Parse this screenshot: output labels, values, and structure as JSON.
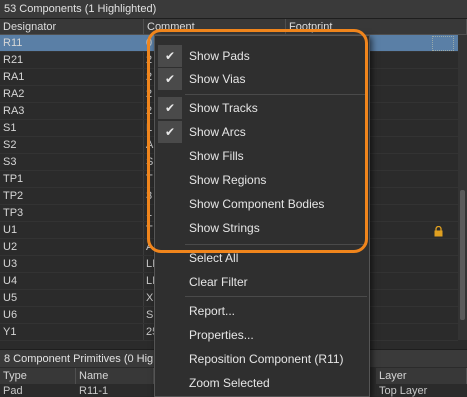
{
  "panel": {
    "title": "53 Components (1 Highlighted)",
    "columns": [
      "Designator",
      "Comment",
      "Footprint"
    ]
  },
  "rows": [
    {
      "designator": "R11",
      "comment": "0",
      "footprint": "",
      "selected": true
    },
    {
      "designator": "R21",
      "comment": "2"
    },
    {
      "designator": "RA1",
      "comment": "2"
    },
    {
      "designator": "RA2",
      "comment": "2"
    },
    {
      "designator": "RA3",
      "comment": "2"
    },
    {
      "designator": "S1",
      "comment": "L"
    },
    {
      "designator": "S2",
      "comment": "A"
    },
    {
      "designator": "S3",
      "comment": "S"
    },
    {
      "designator": "TP1",
      "comment": "T"
    },
    {
      "designator": "TP2",
      "comment": "3"
    },
    {
      "designator": "TP3",
      "comment": "1"
    },
    {
      "designator": "U1",
      "comment": "T"
    },
    {
      "designator": "U2",
      "comment": "A"
    },
    {
      "designator": "U3",
      "comment": "LM"
    },
    {
      "designator": "U4",
      "comment": "LM"
    },
    {
      "designator": "U5",
      "comment": "XC"
    },
    {
      "designator": "U6",
      "comment": "SN"
    },
    {
      "designator": "Y1",
      "comment": "25"
    }
  ],
  "bottom": {
    "title": "8 Component Primitives (0 Hig",
    "columns": [
      "Type",
      "Name",
      "Layer"
    ],
    "row": {
      "type": "Pad",
      "name": "R11-1",
      "layer": "Top Layer"
    }
  },
  "context_menu": {
    "items": [
      {
        "label": "Show Pads",
        "checked": true
      },
      {
        "label": "Show Vias",
        "checked": true
      },
      {
        "label": "Show Tracks",
        "checked": true
      },
      {
        "label": "Show Arcs",
        "checked": true
      },
      {
        "label": "Show Fills",
        "checked": false
      },
      {
        "label": "Show Regions",
        "checked": false
      },
      {
        "label": "Show Component Bodies",
        "checked": false
      },
      {
        "label": "Show Strings",
        "checked": false
      },
      {
        "label": "Select All"
      },
      {
        "label": "Clear Filter"
      },
      {
        "label": "Report..."
      },
      {
        "label": "Properties..."
      },
      {
        "label": "Reposition Component (R11)"
      },
      {
        "label": "Zoom Selected"
      }
    ],
    "check_glyph": "✔"
  },
  "colors": {
    "highlight_outline": "#f0851c",
    "selected_row": "#5a7fa6",
    "background": "#2b2b2b"
  },
  "icons": {
    "lock": "lock-icon"
  }
}
